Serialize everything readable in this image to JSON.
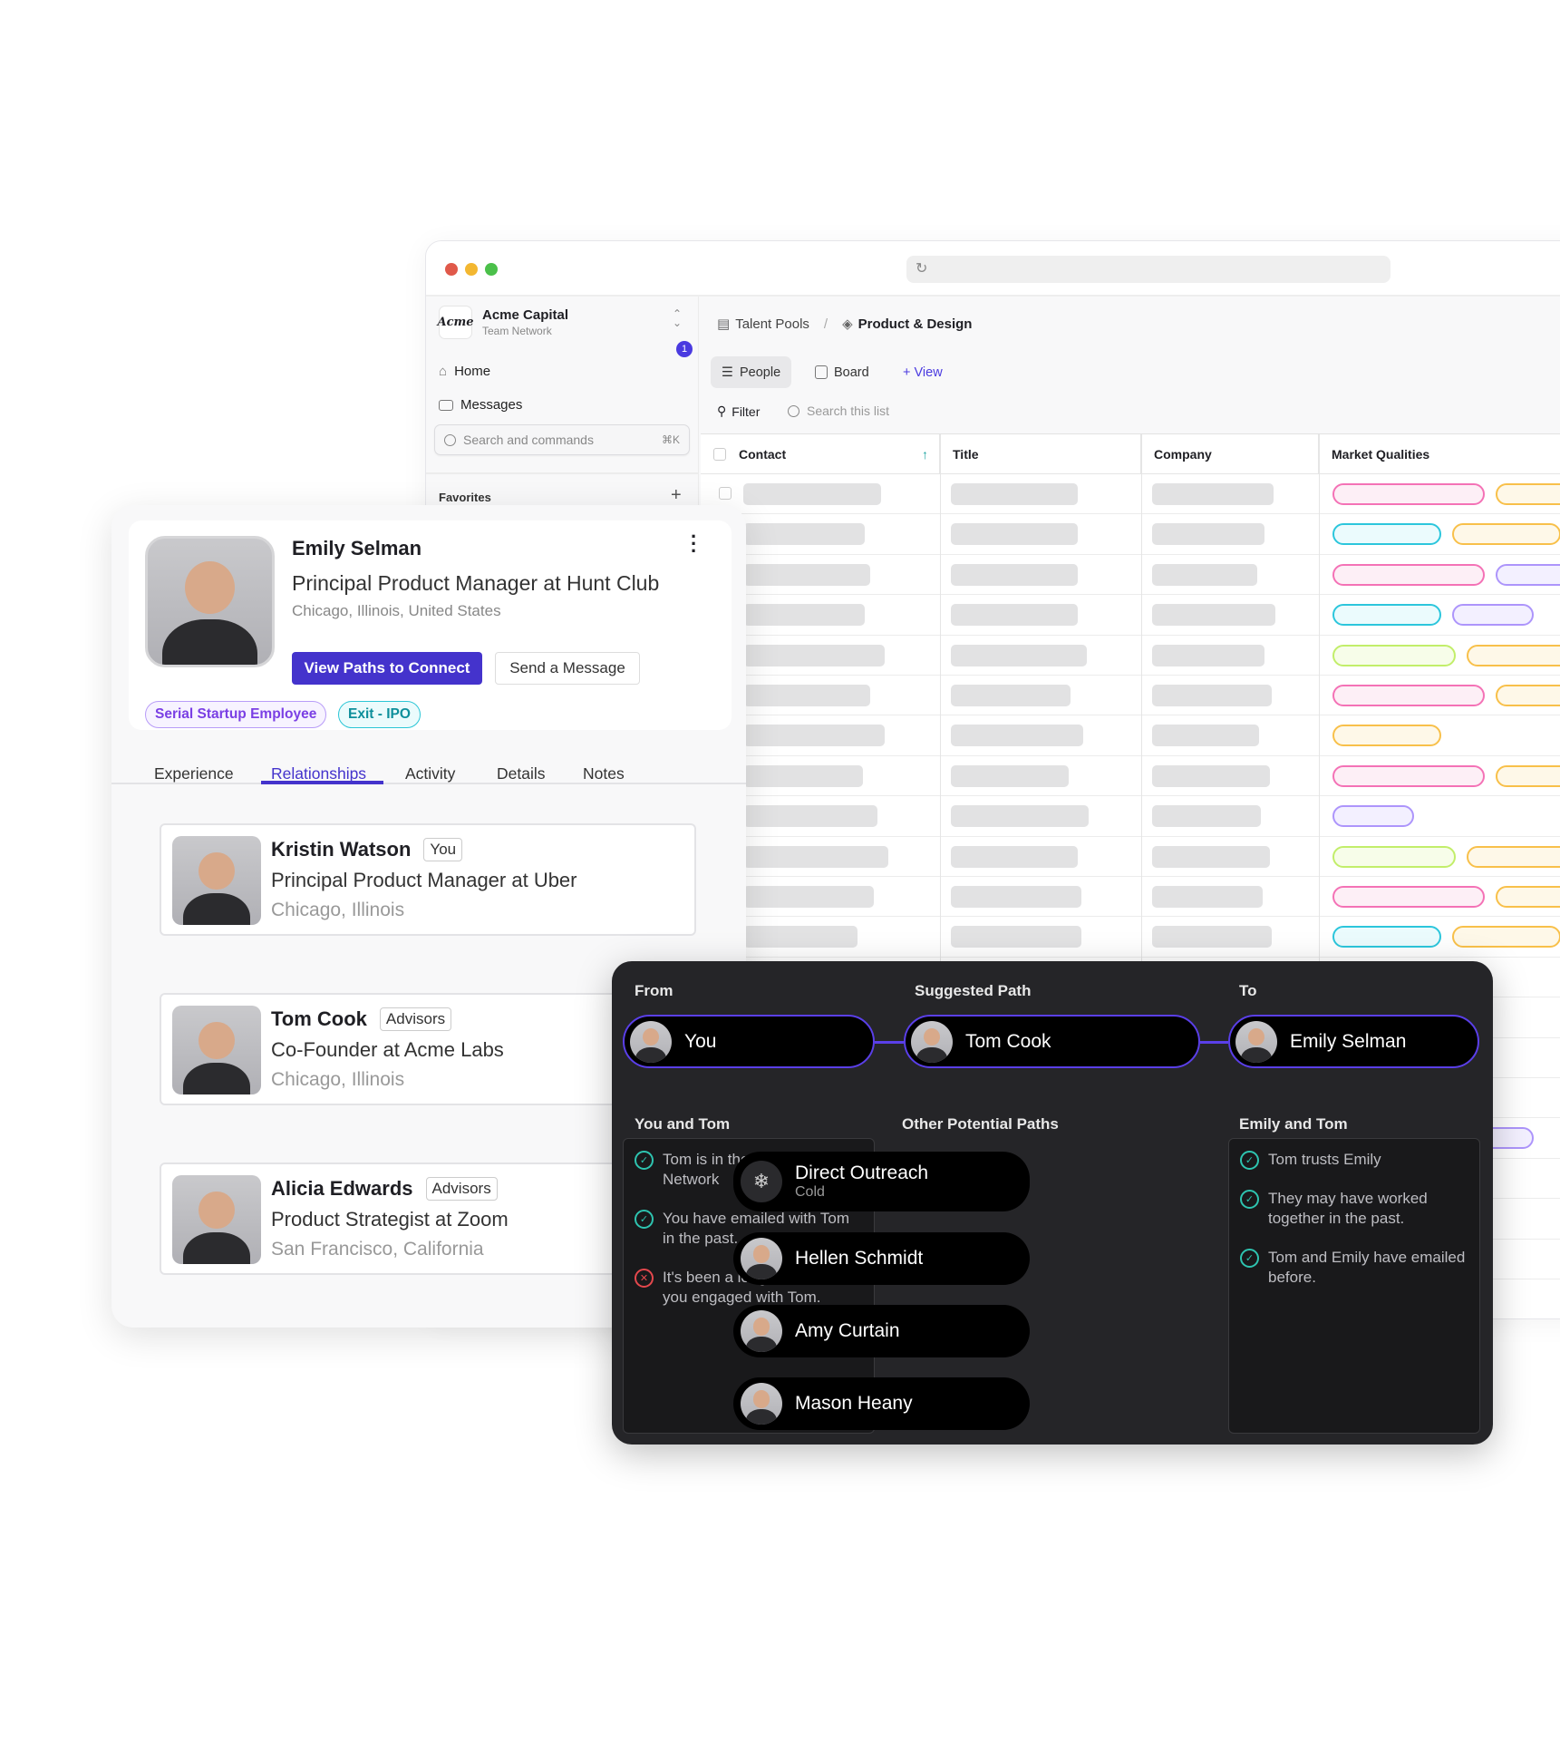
{
  "browser": {
    "traffic_lights": [
      "#e0594a",
      "#f3b731",
      "#4bc04a"
    ]
  },
  "sidebar": {
    "workspace": "Acme Capital",
    "workspace_sub": "Team Network",
    "logo": "Acme",
    "home": "Home",
    "messages": "Messages",
    "messages_badge": "1",
    "search_placeholder": "Search and commands",
    "search_shortcut": "⌘K",
    "favorites": "Favorites"
  },
  "breadcrumb": {
    "parent": "Talent Pools",
    "current": "Product & Design"
  },
  "views": {
    "people": "People",
    "board": "Board",
    "add_view": "+ View"
  },
  "toolbar": {
    "filter": "Filter",
    "search_placeholder": "Search this list"
  },
  "table": {
    "columns": [
      "Contact",
      "Title",
      "Company",
      "Market Qualities"
    ],
    "market_rows": [
      [
        "pink",
        "yellow"
      ],
      [
        "cyan",
        "yellow"
      ],
      [
        "pink",
        "purple"
      ],
      [
        "cyan",
        "purple"
      ],
      [
        "green",
        "yellow"
      ],
      [
        "pink",
        "yellow"
      ],
      [
        "yellow"
      ],
      [
        "pink",
        "yellow",
        "purple"
      ],
      [
        "purple"
      ],
      [
        "green",
        "yellow"
      ],
      [
        "pink",
        "yellow"
      ],
      [
        "cyan",
        "yellow",
        "purple"
      ],
      [
        "purple"
      ],
      [
        "cyan"
      ],
      [],
      [],
      [
        "yellow",
        "purple"
      ],
      [
        "yellow"
      ],
      [],
      [
        "cyan"
      ]
    ]
  },
  "pill_colors": {
    "pink": [
      "#f472b6",
      "#fdeff6"
    ],
    "yellow": [
      "#f8c04a",
      "#fef8e8"
    ],
    "cyan": [
      "#2cc6dc",
      "#ebfbfd"
    ],
    "purple": [
      "#ad95fb",
      "#f3f0ff"
    ],
    "green": [
      "#c2ee6a",
      "#f7fde9"
    ]
  },
  "profile": {
    "name": "Emily Selman",
    "title": "Principal Product Manager at Hunt Club",
    "location": "Chicago, Illinois, United States",
    "primary_button": "View Paths to Connect",
    "secondary_button": "Send a Message",
    "tags": [
      "Serial Startup Employee",
      "Exit - IPO"
    ],
    "tabs": [
      "Experience",
      "Relationships",
      "Activity",
      "Details",
      "Notes"
    ],
    "active_tab": "Relationships",
    "accent": "#4433cc"
  },
  "relationships": [
    {
      "name": "Kristin Watson",
      "badge": "You",
      "title": "Principal Product Manager at Uber",
      "location": "Chicago, Illinois"
    },
    {
      "name": "Tom Cook",
      "badge": "Advisors",
      "title": "Co-Founder at Acme Labs",
      "location": "Chicago, Illinois"
    },
    {
      "name": "Alicia Edwards",
      "badge": "Advisors",
      "title": "Product Strategist at Zoom",
      "location": "San Francisco, California"
    }
  ],
  "paths": {
    "from_label": "From",
    "suggested_label": "Suggested Path",
    "to_label": "To",
    "from": "You",
    "suggested": "Tom Cook",
    "to": "Emily Selman",
    "left_heading": "You and Tom",
    "middle_heading": "Other Potential Paths",
    "right_heading": "Emily and Tom",
    "left_facts": [
      {
        "text": "Tom is in the Advisor Network",
        "ok": true
      },
      {
        "text": "You have emailed with Tom in the past.",
        "ok": true
      },
      {
        "text": "It's been a long time since you engaged with Tom.",
        "ok": false
      }
    ],
    "right_facts": [
      {
        "text": "Tom trusts Emily",
        "ok": true
      },
      {
        "text": "They may have worked together in the past.",
        "ok": true
      },
      {
        "text": "Tom and Emily have emailed before.",
        "ok": true
      }
    ],
    "direct": {
      "title": "Direct Outreach",
      "sub": "Cold",
      "icon": "snowflake-icon"
    },
    "others": [
      "Hellen Schmidt",
      "Amy Curtain",
      "Mason Heany"
    ]
  }
}
